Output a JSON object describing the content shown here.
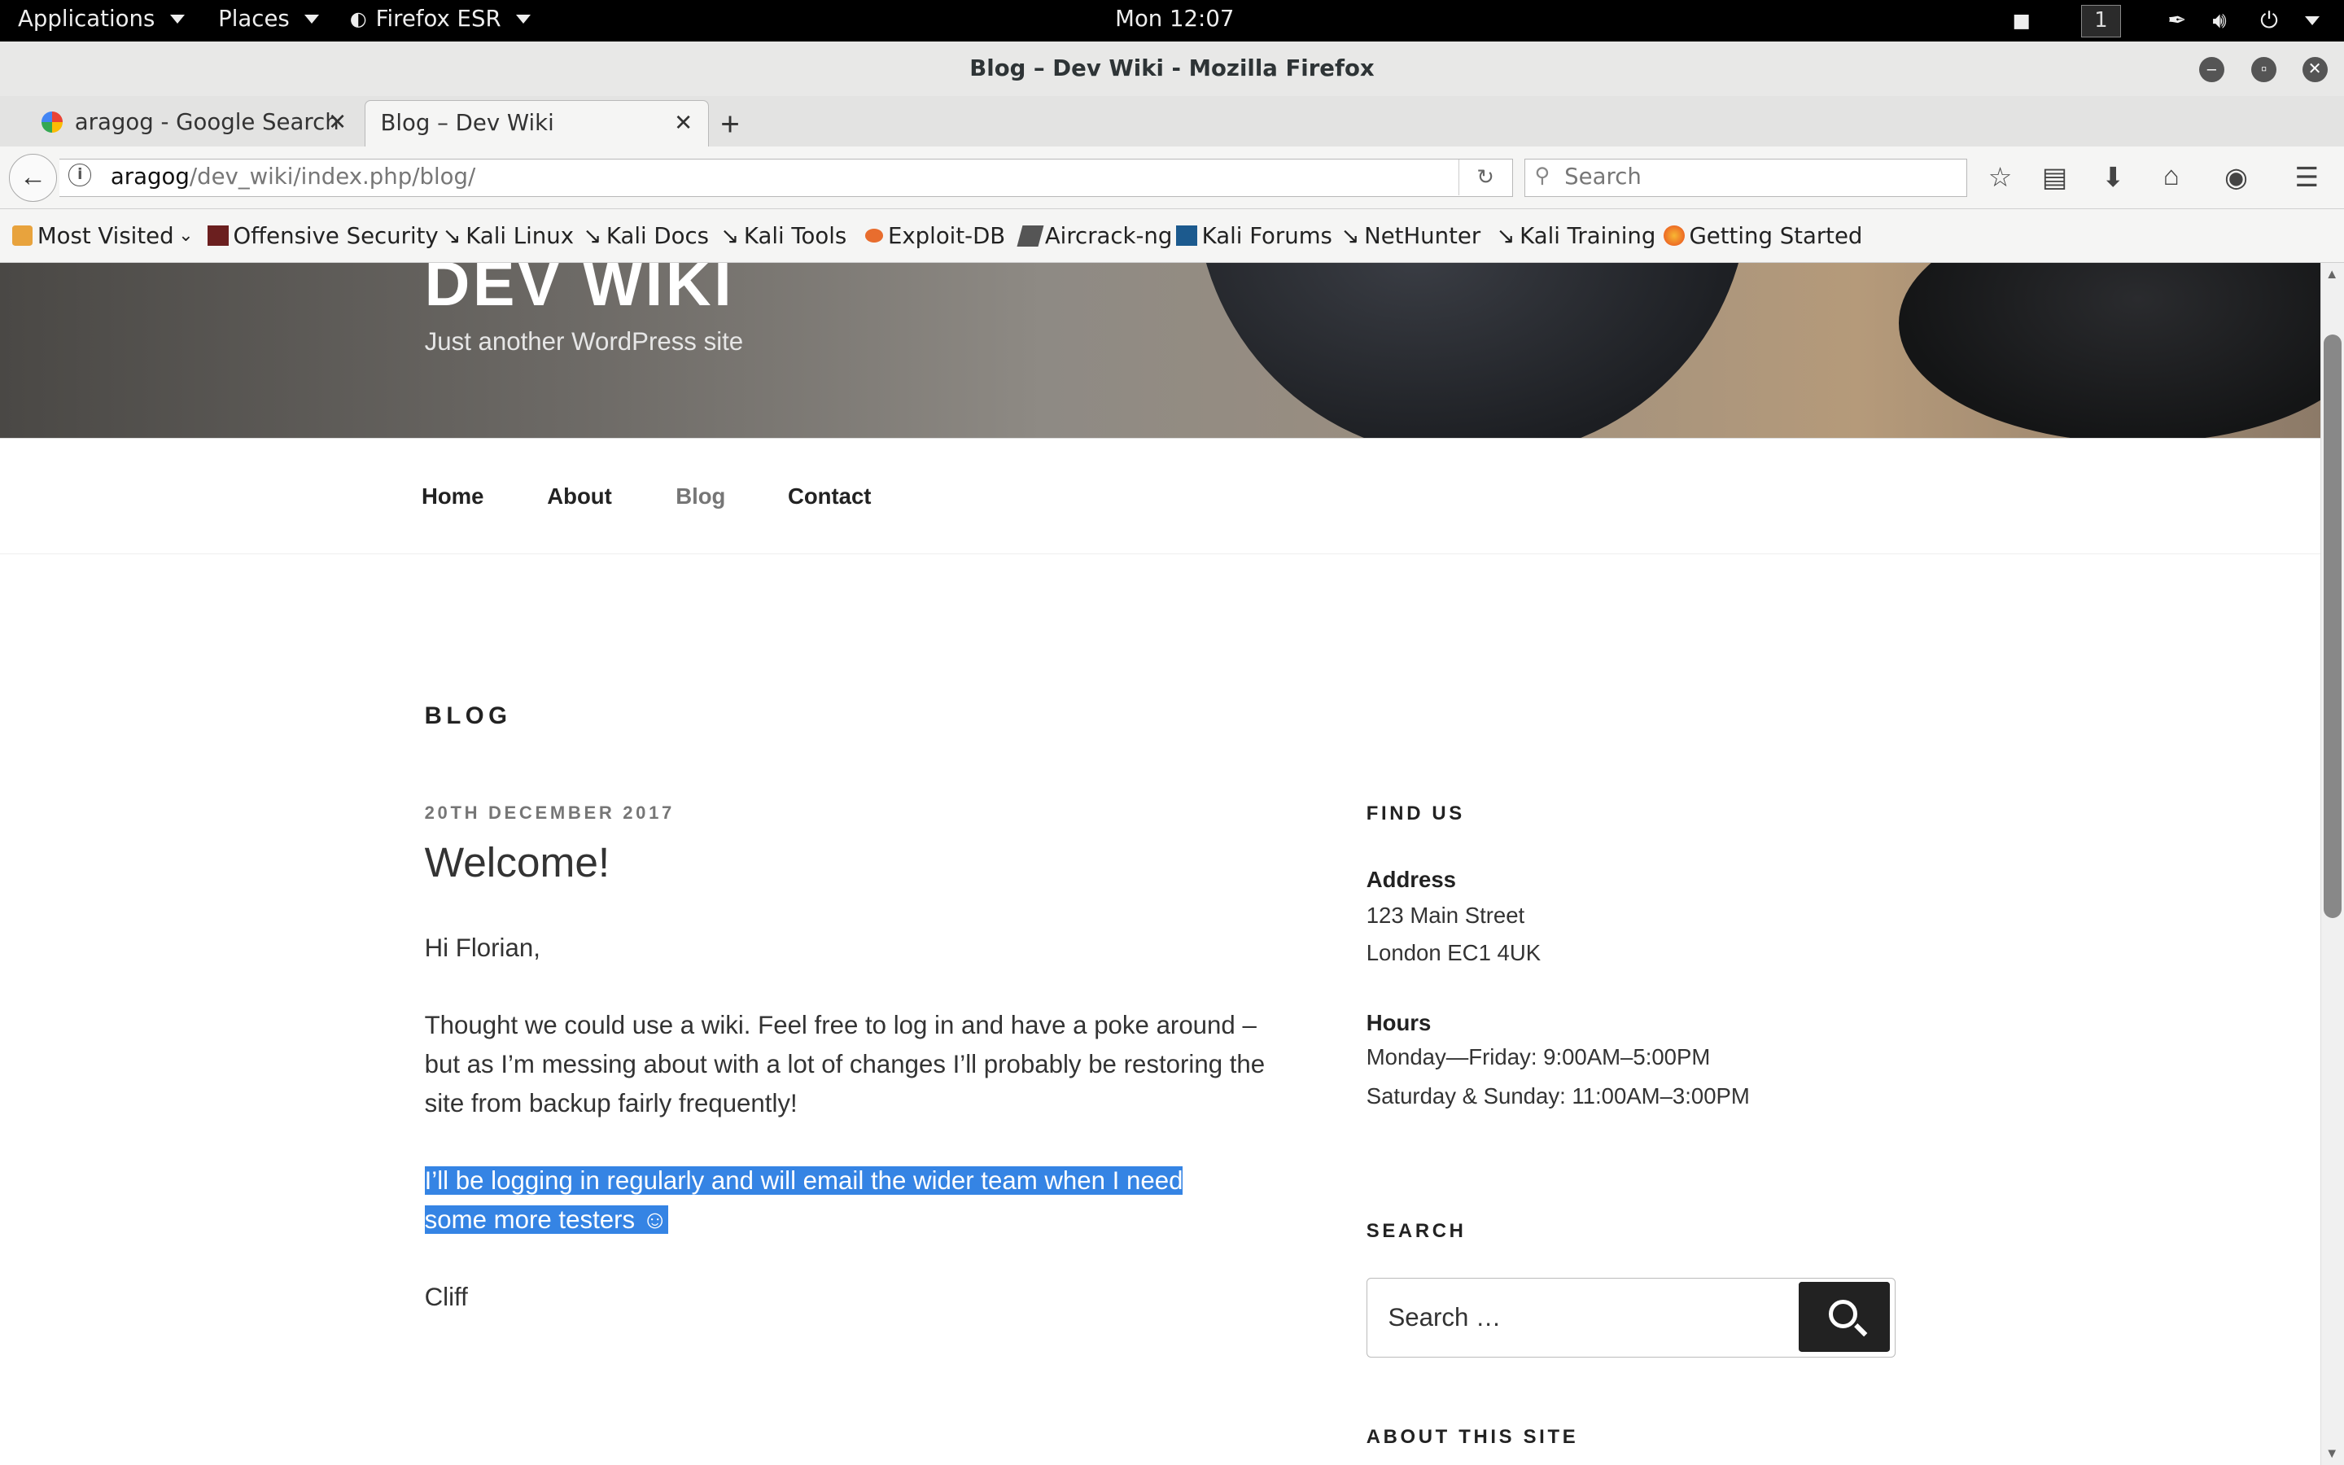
{
  "desktop": {
    "applications_label": "Applications",
    "places_label": "Places",
    "firefox_label": "Firefox ESR",
    "clock": "Mon 12:07",
    "workspace": "1"
  },
  "window": {
    "title": "Blog – Dev Wiki - Mozilla Firefox"
  },
  "tabs": [
    {
      "label": "aragog - Google Search",
      "active": false
    },
    {
      "label": "Blog – Dev Wiki",
      "active": true
    }
  ],
  "navbar": {
    "url_host": "aragog",
    "url_path": "/dev_wiki/index.php/blog/",
    "search_placeholder": "Search"
  },
  "bookmarks": [
    {
      "label": "Most Visited",
      "icon": "folder-icon"
    },
    {
      "label": "Offensive Security",
      "icon": "offsec-icon"
    },
    {
      "label": "Kali Linux",
      "icon": "kali-icon"
    },
    {
      "label": "Kali Docs",
      "icon": "kali-icon"
    },
    {
      "label": "Kali Tools",
      "icon": "kali-icon"
    },
    {
      "label": "Exploit-DB",
      "icon": "exploitdb-icon"
    },
    {
      "label": "Aircrack-ng",
      "icon": "aircrack-icon"
    },
    {
      "label": "Kali Forums",
      "icon": "forums-icon"
    },
    {
      "label": "NetHunter",
      "icon": "kali-icon"
    },
    {
      "label": "Kali Training",
      "icon": "kali-icon"
    },
    {
      "label": "Getting Started",
      "icon": "firefox-icon"
    }
  ],
  "site": {
    "title": "DEV WIKI",
    "description": "Just another WordPress site"
  },
  "menu": [
    {
      "label": "Home",
      "current": false
    },
    {
      "label": "About",
      "current": false
    },
    {
      "label": "Blog",
      "current": true
    },
    {
      "label": "Contact",
      "current": false
    }
  ],
  "main": {
    "heading": "BLOG",
    "post": {
      "date": "20TH DECEMBER 2017",
      "title": "Welcome!",
      "greeting": "Hi Florian,",
      "para1": "Thought we could use a wiki.  Feel free to log in and have a poke around – but as I’m messing about with a lot of changes I’ll probably be restoring the site from backup fairly frequently!",
      "para2_line1": "I’ll be logging in regularly and will email the wider team when I need",
      "para2_line2": "some more testers ☺",
      "signoff": "Cliff"
    }
  },
  "sidebar": {
    "find_us_heading": "FIND US",
    "address_label": "Address",
    "address_line1": "123 Main Street",
    "address_line2": "London EC1 4UK",
    "hours_label": "Hours",
    "hours_line1": "Monday—Friday: 9:00AM–5:00PM",
    "hours_line2": "Saturday & Sunday: 11:00AM–3:00PM",
    "search_heading": "SEARCH",
    "search_placeholder": "Search …",
    "about_heading": "ABOUT THIS SITE"
  },
  "colors": {
    "selection": "#3584e4",
    "menu_current": "#767676"
  }
}
